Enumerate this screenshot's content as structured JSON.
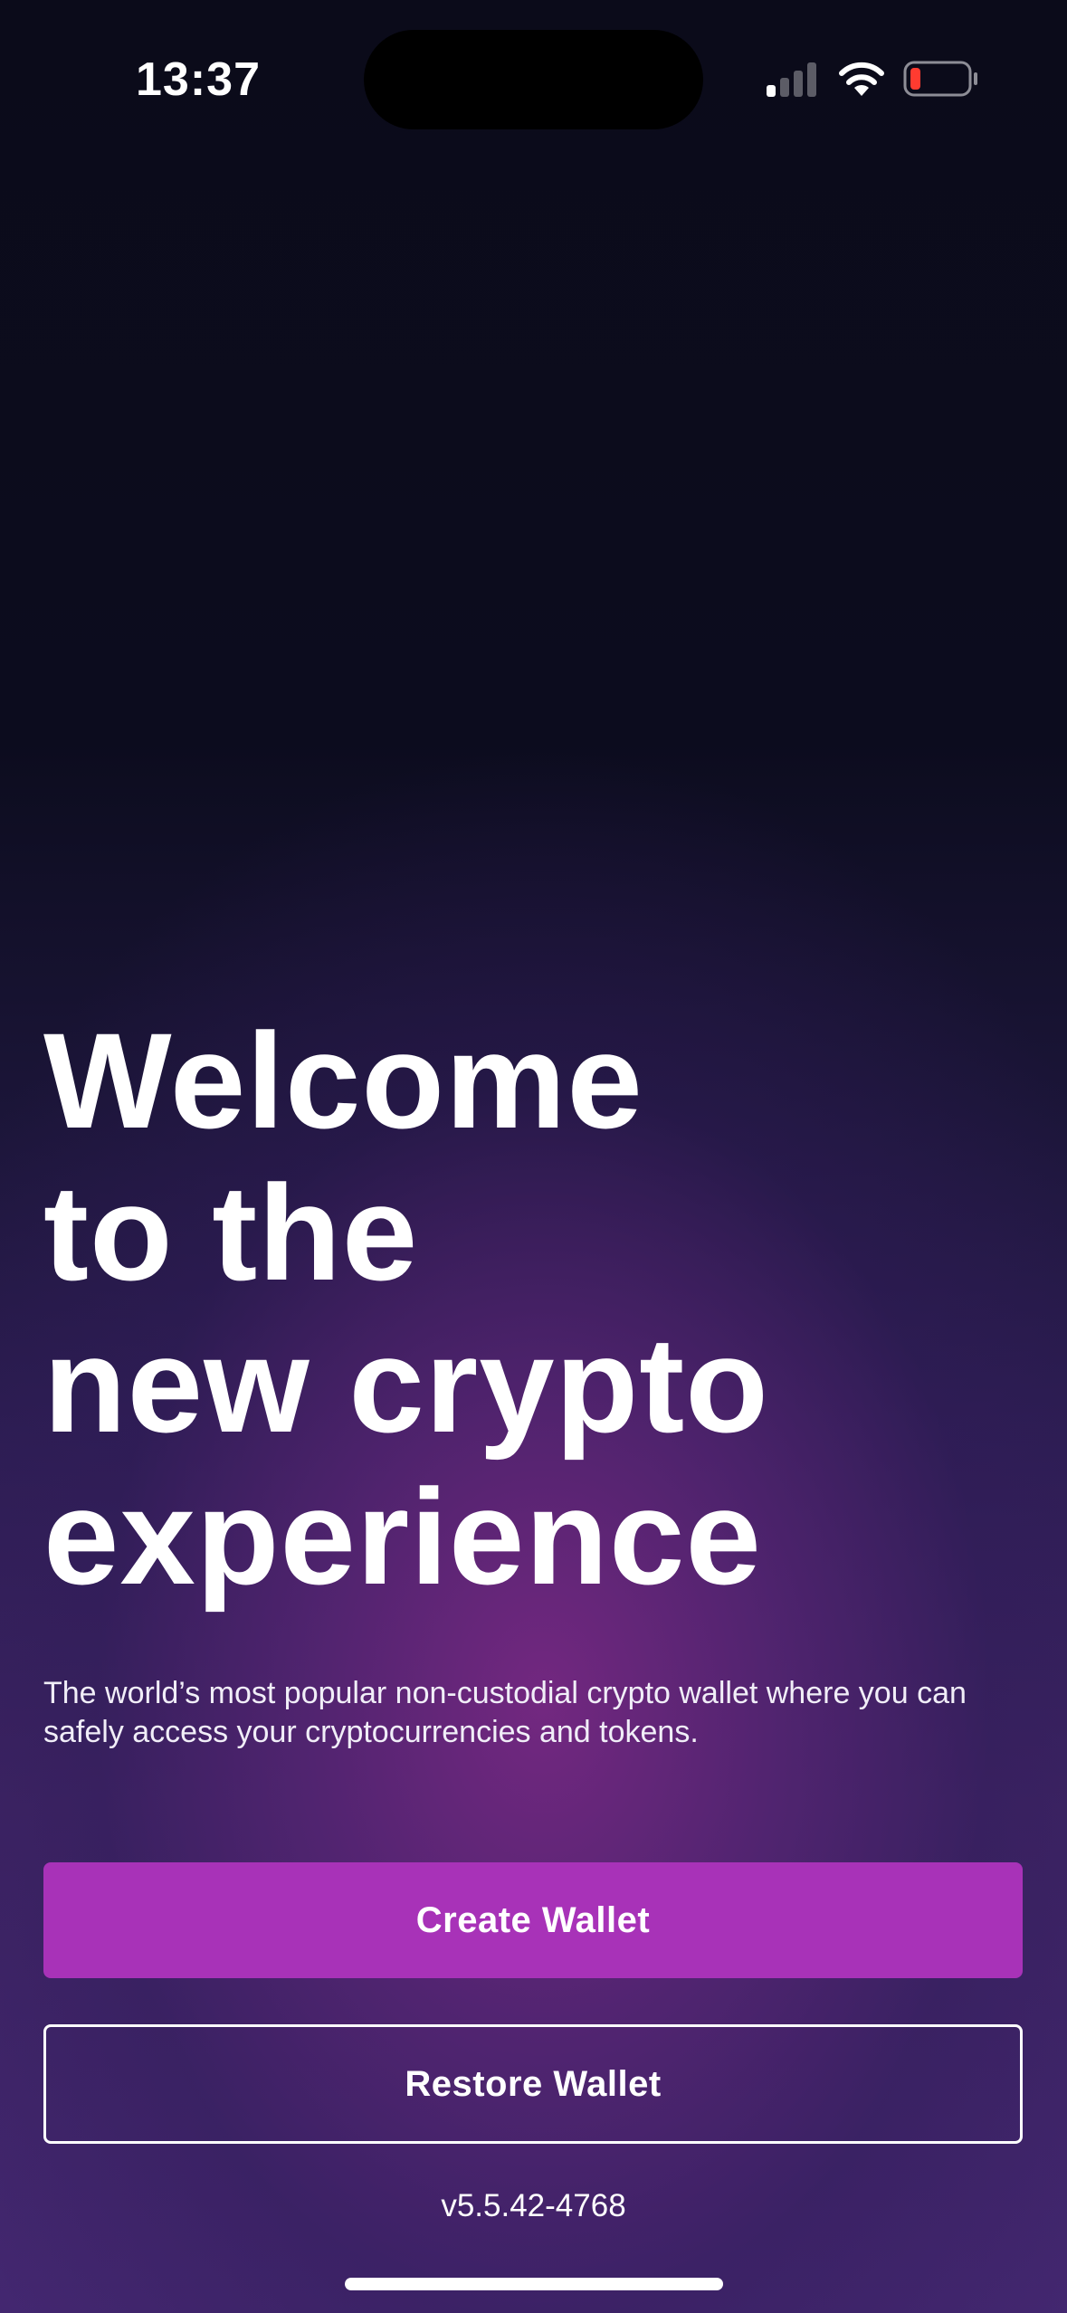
{
  "status_bar": {
    "time": "13:37",
    "signal_icon": "cellular-signal-icon",
    "wifi_icon": "wifi-icon",
    "battery_icon": "battery-low-icon"
  },
  "welcome": {
    "headline_lines": [
      "Welcome",
      "to the",
      "new crypto",
      "experience"
    ],
    "subtitle": "The world’s most popular non-custodial crypto wallet where you can safely access your cryptocurrencies and tokens."
  },
  "actions": {
    "create_label": "Create Wallet",
    "restore_label": "Restore Wallet"
  },
  "footer": {
    "version": "v5.5.42-4768"
  },
  "colors": {
    "primary_button": "#a832b8",
    "battery_low": "#ff3b30",
    "background_top": "#0b0b1a",
    "background_glow": "#7a2a86"
  }
}
